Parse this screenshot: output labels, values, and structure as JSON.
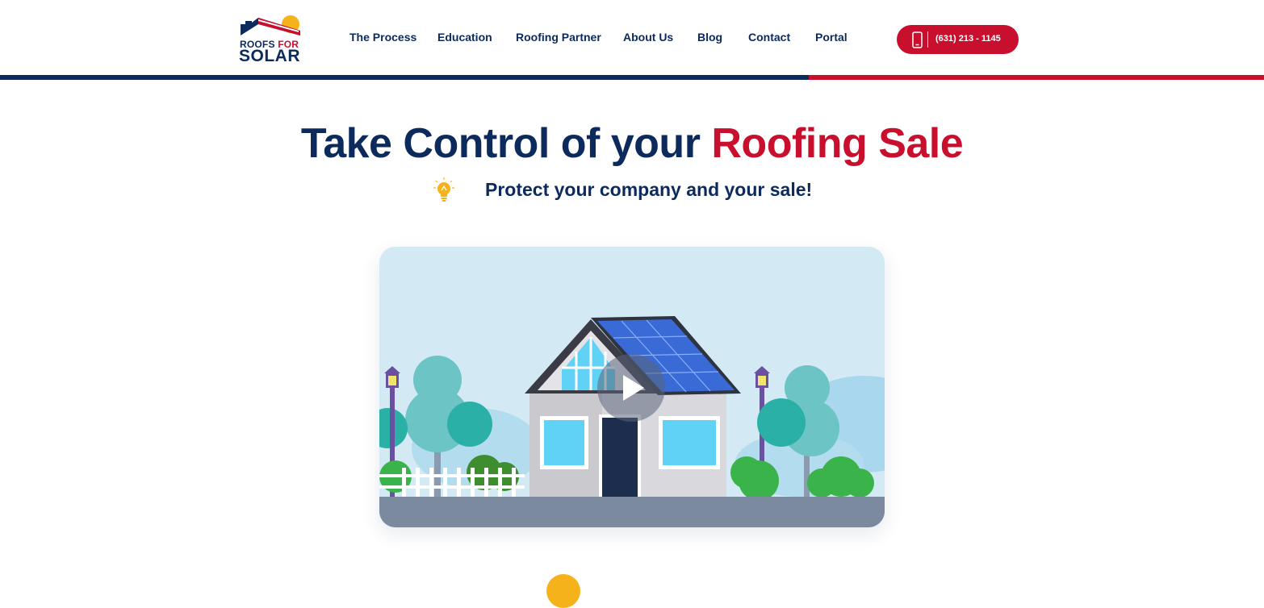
{
  "header": {
    "logo": {
      "line1_a": "ROOFS",
      "line1_b": "FOR",
      "line2": "SOLAR"
    },
    "nav": [
      {
        "label": "The Process"
      },
      {
        "label": "Education"
      },
      {
        "label": "Roofing Partner"
      },
      {
        "label": "About Us"
      },
      {
        "label": "Blog"
      },
      {
        "label": "Contact"
      },
      {
        "label": "Portal"
      }
    ],
    "phone": {
      "number": "(631) 213 - 1145",
      "icon": "mobile-phone-icon"
    }
  },
  "colors": {
    "navy": "#0c2a5b",
    "red": "#c8102e",
    "yellow": "#f5b21a",
    "sky": "#d3eaf5"
  },
  "hero": {
    "title_main": "Take Control of your ",
    "title_accent": "Roofing Sale",
    "subtitle": "Protect your company and your sale!",
    "subtitle_icon": "lightbulb-icon"
  },
  "video": {
    "play_icon": "play-icon"
  }
}
